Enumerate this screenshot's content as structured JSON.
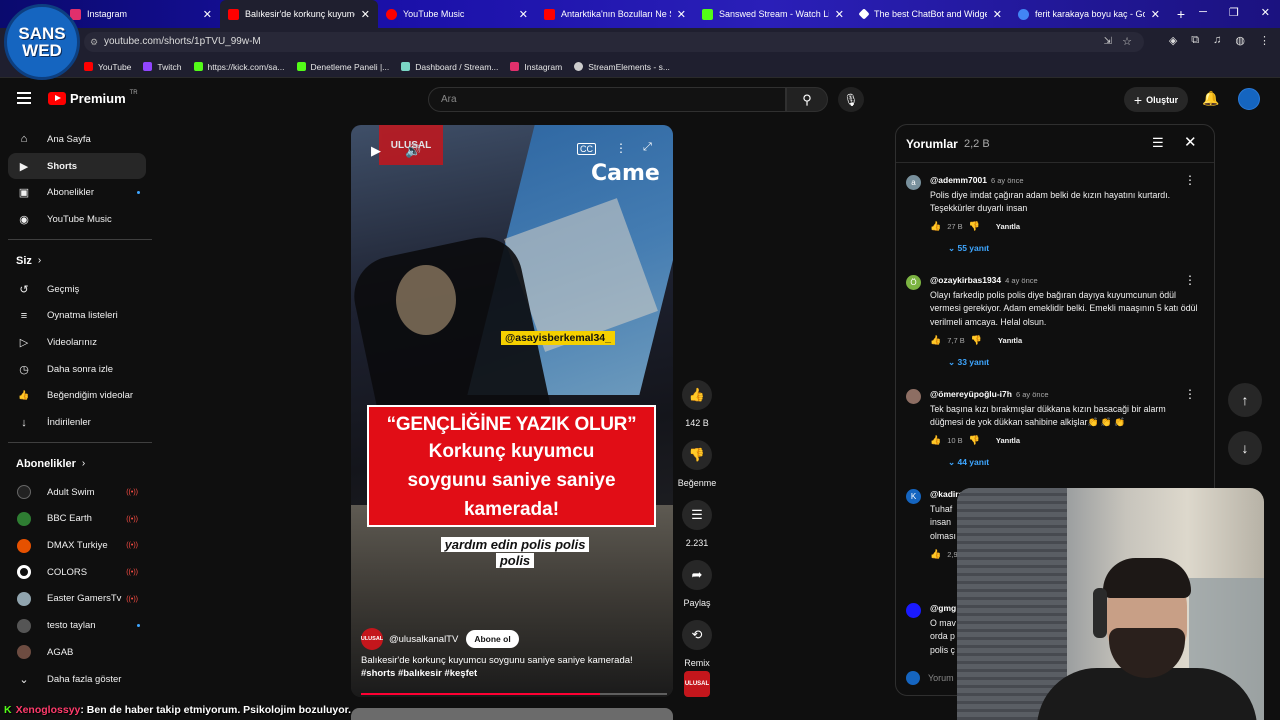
{
  "browser": {
    "tabs": [
      {
        "title": "Instagram",
        "color": "#e1306c",
        "active": false
      },
      {
        "title": "Balıkesir'de korkunç kuyumcu s",
        "color": "#ff0000",
        "active": true
      },
      {
        "title": "YouTube Music",
        "color": "#ff0000",
        "active": false
      },
      {
        "title": "Antarktika'nın Bozulları Ne Sak",
        "color": "#ff0000",
        "active": false
      },
      {
        "title": "Sanswed Stream - Watch Live o",
        "color": "#53fc18",
        "active": false
      },
      {
        "title": "The best ChatBot and Widgets",
        "color": "#ffffff",
        "active": false
      },
      {
        "title": "ferit karakaya boyu kaç - Goog",
        "color": "#4285f4",
        "active": false
      }
    ],
    "url": "youtube.com/shorts/1pTVU_99w-M",
    "bookmarks": [
      {
        "label": "YouTube",
        "color": "#ff0000"
      },
      {
        "label": "Twitch",
        "color": "#9146ff"
      },
      {
        "label": "https://kick.com/sa...",
        "color": "#53fc18"
      },
      {
        "label": "Denetleme Paneli |...",
        "color": "#53fc18"
      },
      {
        "label": "Dashboard / Stream...",
        "color": "#7bd7c6"
      },
      {
        "label": "Instagram",
        "color": "#e1306c"
      },
      {
        "label": "StreamElements - s...",
        "color": "#cccccc"
      }
    ]
  },
  "logo": {
    "line1": "SANS",
    "line2": "WED"
  },
  "header": {
    "brand": "Premium",
    "brand_sup": "TR",
    "search_placeholder": "Ara",
    "create_label": "Oluştur"
  },
  "sidebar": {
    "main": [
      {
        "label": "Ana Sayfa",
        "icon": "⌂"
      },
      {
        "label": "Shorts",
        "icon": "▶"
      },
      {
        "label": "Abonelikler",
        "icon": "▣"
      },
      {
        "label": "YouTube Music",
        "icon": "◉"
      }
    ],
    "you_heading": "Siz",
    "you": [
      {
        "label": "Geçmiş",
        "icon": "↺"
      },
      {
        "label": "Oynatma listeleri",
        "icon": "≡"
      },
      {
        "label": "Videolarınız",
        "icon": "▷"
      },
      {
        "label": "Daha sonra izle",
        "icon": "◷"
      },
      {
        "label": "Beğendiğim videolar",
        "icon": "👍"
      },
      {
        "label": "İndirilenler",
        "icon": "↓"
      }
    ],
    "subs_heading": "Abonelikler",
    "subs": [
      {
        "label": "Adult Swim",
        "color": "#222222"
      },
      {
        "label": "BBC Earth",
        "color": "#2e7d32"
      },
      {
        "label": "DMAX Turkiye",
        "color": "#e65100"
      },
      {
        "label": "COLORS",
        "color": "#ffffff"
      },
      {
        "label": "Easter GamersTv",
        "color": "#90a4ae"
      },
      {
        "label": "testo taylan",
        "color": "#555555"
      },
      {
        "label": "AGAB",
        "color": "#6d4c41"
      }
    ],
    "show_more": "Daha fazla göster"
  },
  "video": {
    "overlay_tag": "@asayisberkemal34_",
    "overlay_corner": "Came",
    "ulusal": "ULUSAL",
    "banner_line1": "“GENÇLİĞİNE YAZIK OLUR”",
    "banner_line2": "Korkunç kuyumcu",
    "banner_line3": "soygunu saniye saniye",
    "banner_line4": "kamerada!",
    "caption_line1": "yardım edin polis polis",
    "caption_line2": "polis",
    "channel": "@ulusalkanalTV",
    "subscribe": "Abone ol",
    "title": "Balıkesir'de korkunç kuyumcu soygunu saniye saniye kamerada!",
    "hashtags": "#shorts #balıkesir #keşfet",
    "progress": 0.78
  },
  "actions": {
    "likes": "142 B",
    "dislike": "Beğenme",
    "comments": "2.231",
    "share": "Paylaş",
    "remix": "Remix"
  },
  "comments": {
    "title": "Yorumlar",
    "count": "2,2 B",
    "input_placeholder": "Yorum",
    "items": [
      {
        "user": "@ademm7001",
        "time": "6 ay önce",
        "avatar": "a",
        "avatar_color": "#78909c",
        "text": "Polis diye imdat çağıran adam belki de kızın hayatını kurtardı. Teşekkürler duyarlı insan",
        "likes": "27 B",
        "reply_label": "Yanıtla",
        "replies": "55 yanıt"
      },
      {
        "user": "@ozaykirbas1934",
        "time": "4 ay önce",
        "avatar": "Ö",
        "avatar_color": "#7cb342",
        "text": "Olayı farkedip polis polis diye bağıran dayıya kuyumcunun ödül vermesi gerekiyor. Adam emeklidir belki. Emekli maaşının 5 katı ödül verilmeli amcaya. Helal olsun.",
        "likes": "7,7 B",
        "reply_label": "Yanıtla",
        "replies": "33 yanıt"
      },
      {
        "user": "@ömereyüpoğlu-i7h",
        "time": "6 ay önce",
        "avatar": "",
        "avatar_color": "#8d6e63",
        "text": "Tek başına kızı bırakmışlar dükkana kızın basacaği bir alarm düğmesi de yok dükkan sahibine alkişlar👏 👏 👏",
        "likes": "10 B",
        "reply_label": "Yanıtla",
        "replies": "44 yanıt"
      },
      {
        "user": "@kadira",
        "time": "",
        "avatar": "K",
        "avatar_color": "#1565c0",
        "text": "Tuhaf insan olması",
        "likes": "2,9",
        "reply_label": "",
        "replies": ""
      },
      {
        "user": "@gmg",
        "time": "",
        "avatar": "",
        "avatar_color": "#1a1aff",
        "text": "O mav orda p polis ç",
        "likes": "",
        "reply_label": "",
        "replies": ""
      }
    ]
  },
  "chat": {
    "name": "Xenoglossyy",
    "message": ": Ben de haber takip etmiyorum. Psikolojim bozuluyor."
  }
}
